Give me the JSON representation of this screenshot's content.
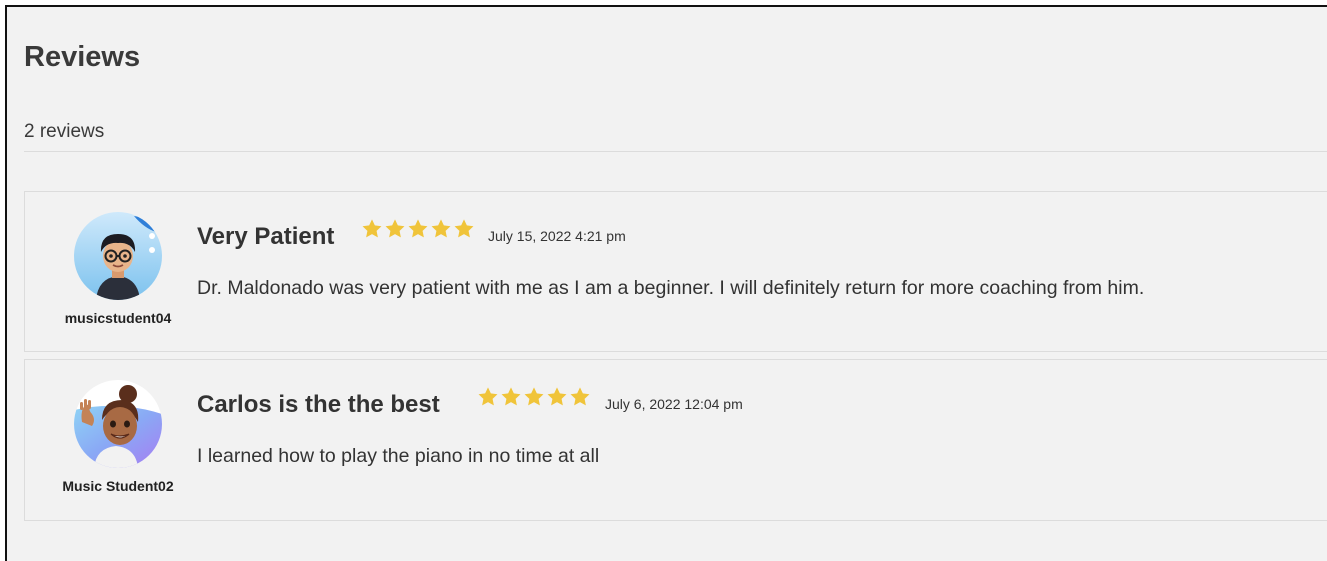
{
  "section": {
    "title": "Reviews",
    "count_label": "2 reviews"
  },
  "reviews": [
    {
      "username": "musicstudent04",
      "title": "Very Patient",
      "rating": 5,
      "rating_max": 5,
      "date": "July 15, 2022 4:21 pm",
      "body": "Dr. Maldonado was very patient with me as I am a beginner. I will definitely return for more coaching from him.",
      "avatar": "memoji-boy-glasses-icon"
    },
    {
      "username": "Music Student02",
      "title": "Carlos is the the best",
      "rating": 5,
      "rating_max": 5,
      "date": "July 6, 2022 12:04 pm",
      "body": "I learned how to play the piano in no time at all",
      "avatar": "memoji-girl-waving-icon"
    }
  ],
  "colors": {
    "star": "#f0c43a",
    "background": "#f2f2f2",
    "text": "#333333",
    "border": "#dcdcdc"
  }
}
